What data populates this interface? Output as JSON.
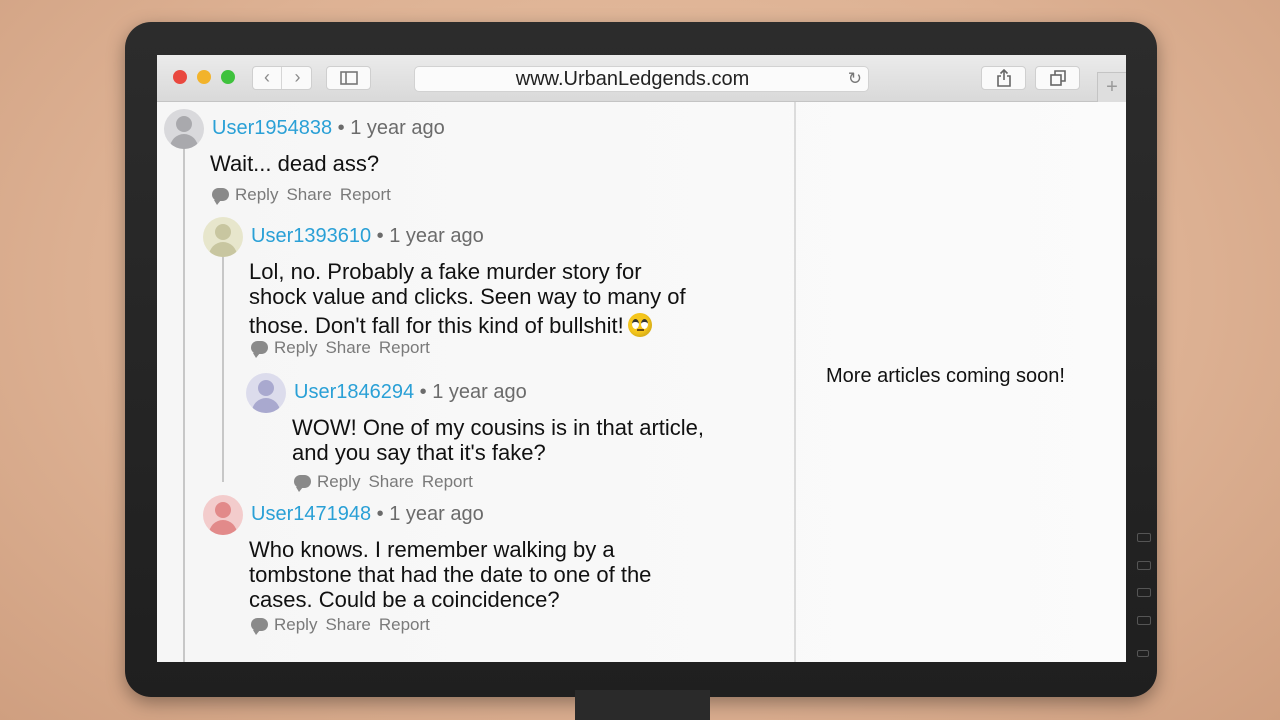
{
  "browser": {
    "url": "www.UrbanLedgends.com",
    "back_icon": "chevron-left-icon",
    "forward_icon": "chevron-right-icon",
    "sidebar_icon": "sidebar-icon",
    "reload_icon": "reload-icon",
    "share_icon": "share-icon",
    "tabs_icon": "tabs-icon",
    "new_tab_label": "+"
  },
  "comments": [
    {
      "user": "User1954838",
      "time": "• 1 year ago",
      "lines": [
        "Wait... dead ass?"
      ],
      "avatar_color": "#a9a9ad"
    },
    {
      "user": "User1393610",
      "time": "• 1 year ago",
      "lines": [
        "Lol, no. Probably a fake murder story for",
        "shock value and clicks. Seen way to many of",
        "those. Don't fall for this kind of bullshit!"
      ],
      "emoji": "face-with-rolling-eyes",
      "avatar_color": "#c8c6a0"
    },
    {
      "user": "User1846294",
      "time": "• 1 year ago",
      "lines": [
        "WOW! One of my cousins is in that article,",
        "and you say that it's fake?"
      ],
      "avatar_color": "#a9a9cf"
    },
    {
      "user": "User1471948",
      "time": "• 1 year ago",
      "lines": [
        "Who knows. I remember walking by a",
        "tombstone that had the date to one of the",
        "cases. Could be a coincidence?"
      ],
      "avatar_color": "#e28a8a"
    }
  ],
  "actions": {
    "reply": "Reply",
    "share": "Share",
    "report": "Report"
  },
  "sidebar": {
    "message": "More articles coming soon!"
  },
  "colors": {
    "username": "#2aa0d6",
    "close": "#e9483f",
    "minimize": "#f2b32b",
    "zoom": "#3fc23d"
  }
}
